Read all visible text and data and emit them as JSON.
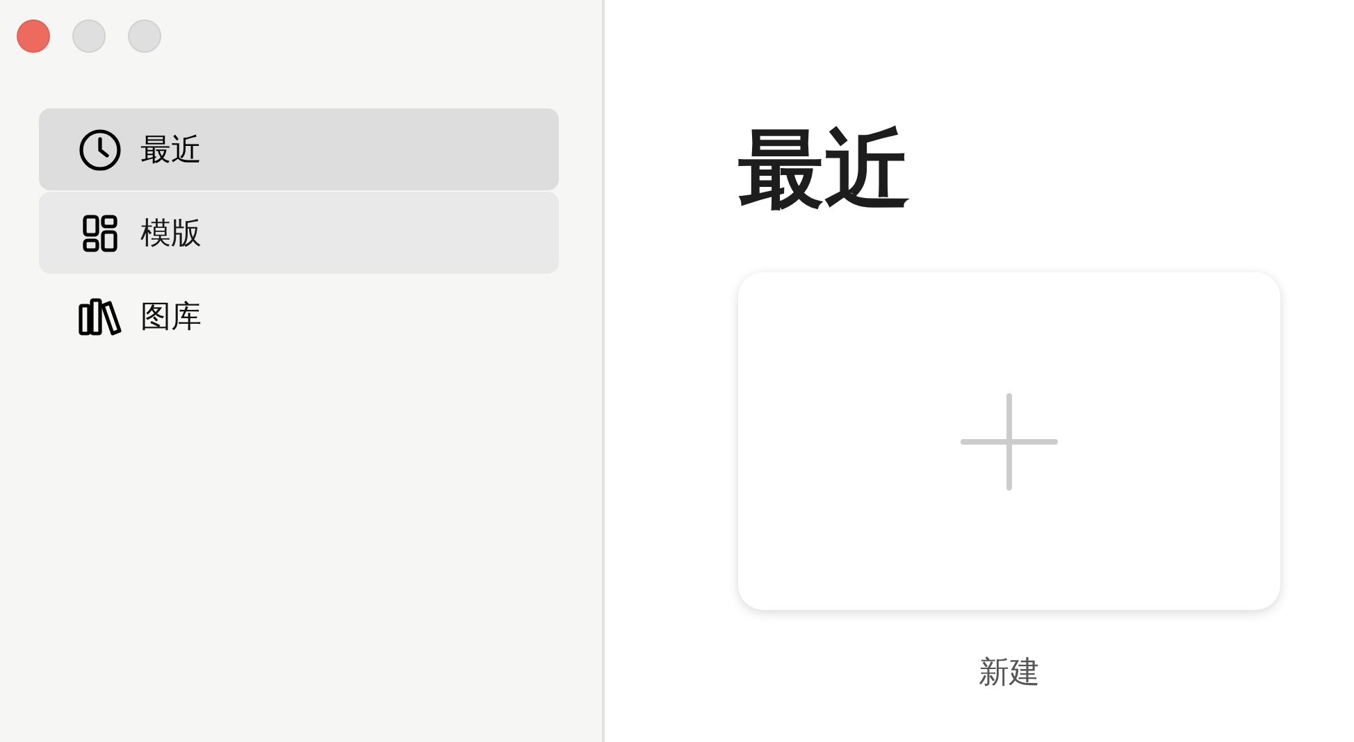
{
  "window": {
    "controls": [
      {
        "kind": "close"
      },
      {
        "kind": "minimize"
      },
      {
        "kind": "zoom"
      }
    ]
  },
  "sidebar": {
    "items": [
      {
        "label": "最近",
        "selected": true,
        "hovered": false
      },
      {
        "label": "模版",
        "selected": false,
        "hovered": true
      },
      {
        "label": "图库",
        "selected": false,
        "hovered": false
      }
    ]
  },
  "main": {
    "title": "最近",
    "new_card": {
      "label": "新建"
    }
  }
}
